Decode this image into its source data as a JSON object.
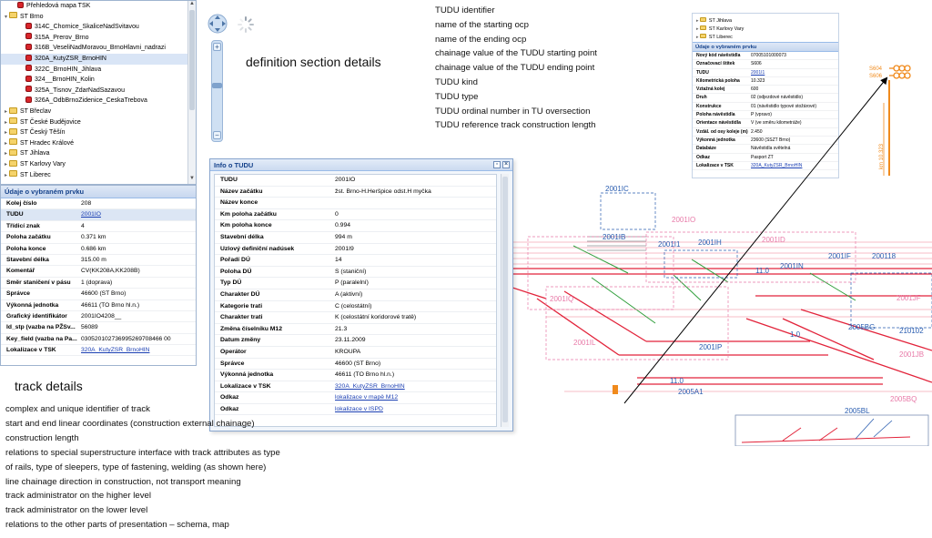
{
  "tree": {
    "items": [
      {
        "label": "Přehledová mapa TSK",
        "indent": 1,
        "icon": "red-layer-icon",
        "expander": ""
      },
      {
        "label": "ST Brno",
        "indent": 0,
        "icon": "folder-icon",
        "expander": "▾"
      },
      {
        "label": "314C_Chornice_SkaliceNadSvitavou",
        "indent": 2,
        "icon": "red-layer-icon",
        "expander": ""
      },
      {
        "label": "315A_Prerov_Brno",
        "indent": 2,
        "icon": "red-layer-icon",
        "expander": ""
      },
      {
        "label": "316B_VeseliNadMoravou_BrnoHlavni_nadrazi",
        "indent": 2,
        "icon": "red-layer-icon",
        "expander": ""
      },
      {
        "label": "320A_KutyZSR_BrnoHIN",
        "indent": 2,
        "icon": "red-layer-icon",
        "expander": "",
        "selected": true
      },
      {
        "label": "322C_BrnoHIN_Jihlava",
        "indent": 2,
        "icon": "red-layer-icon",
        "expander": ""
      },
      {
        "label": "324__BrnoHIN_Kolin",
        "indent": 2,
        "icon": "red-layer-icon",
        "expander": ""
      },
      {
        "label": "325A_Tisnov_ZdarNadSazavou",
        "indent": 2,
        "icon": "red-layer-icon",
        "expander": ""
      },
      {
        "label": "326A_OdbBrnoZidenice_CeskaTrebova",
        "indent": 2,
        "icon": "red-layer-icon",
        "expander": ""
      },
      {
        "label": "ST Břeclav",
        "indent": 0,
        "icon": "folder-icon",
        "expander": "▸"
      },
      {
        "label": "ST České Budějovice",
        "indent": 0,
        "icon": "folder-icon",
        "expander": "▸"
      },
      {
        "label": "ST Český Těšín",
        "indent": 0,
        "icon": "folder-icon",
        "expander": "▸"
      },
      {
        "label": "ST Hradec Králové",
        "indent": 0,
        "icon": "folder-icon",
        "expander": "▸"
      },
      {
        "label": "ST Jihlava",
        "indent": 0,
        "icon": "folder-icon",
        "expander": "▸"
      },
      {
        "label": "ST Karlovy Vary",
        "indent": 0,
        "icon": "folder-icon",
        "expander": "▸"
      },
      {
        "label": "ST Liberec",
        "indent": 0,
        "icon": "folder-icon",
        "expander": "▸"
      }
    ]
  },
  "track_panel": {
    "title": "Údaje o vybraném prvku",
    "rows": [
      {
        "k": "Kolej číslo",
        "v": "208"
      },
      {
        "k": "TUDU",
        "v": "2001IO",
        "link": true,
        "hl": true
      },
      {
        "k": "Třídicí znak",
        "v": "4"
      },
      {
        "k": "Poloha začátku",
        "v": "0.371 km"
      },
      {
        "k": "Poloha konce",
        "v": "0.686 km"
      },
      {
        "k": "Stavební délka",
        "v": "315.00 m"
      },
      {
        "k": "Komentář",
        "v": "CV(KK208A,KK208B)"
      },
      {
        "k": "Směr staničení v pásu",
        "v": "1 (doprava)"
      },
      {
        "k": "Správce",
        "v": "46600 (ST Brno)"
      },
      {
        "k": "Výkonná jednotka",
        "v": "46611 (TO Brno hl.n.)"
      },
      {
        "k": "Grafický identifikátor",
        "v": "2001IO4208__"
      },
      {
        "k": "Id_stp (vazba na PŽSv...",
        "v": "56089"
      },
      {
        "k": "Key_field (vazba na Pa...",
        "v": "030520102736995269708466 00"
      },
      {
        "k": "Lokalizace v TSK",
        "v": "320A_KutyZSR_BrnoHIN",
        "link": true
      }
    ]
  },
  "headings": {
    "definition": "definition section details",
    "track": "track details"
  },
  "tudu_notes": [
    "TUDU identifier",
    "name of the starting ocp",
    "name of the ending ocp",
    "chainage value of the TUDU starting point",
    "chainage value of the TUDU ending point",
    "TUDU kind",
    "TUDU type",
    "TUDU ordinal number in TU oversection",
    "TUDU reference track construction length"
  ],
  "track_notes": [
    "complex and unique identifier of track",
    "start and end linear coordinates (construction external chainage)",
    "construction length",
    "relations to special superstructure interface with track attributes as type",
    "of rails, type of sleepers, type of fastening, welding (as shown here)",
    "line chainage direction in construction, not transport meaning",
    "track administrator on the higher level",
    "track administrator on the lower level",
    "relations to the other parts of presentation – schema, map"
  ],
  "info_window": {
    "title": "Info o TUDU",
    "rows": [
      {
        "k": "TUDU",
        "v": "2001IO"
      },
      {
        "k": "Název začátku",
        "v": "žst. Brno-H.Heršpice odst.H myčka"
      },
      {
        "k": "Název konce",
        "v": ""
      },
      {
        "k": "Km poloha začátku",
        "v": "0"
      },
      {
        "k": "Km poloha konce",
        "v": "0.994"
      },
      {
        "k": "Stavební délka",
        "v": "994 m"
      },
      {
        "k": "Uzlový definiční nadúsek",
        "v": "2001I9"
      },
      {
        "k": "Pořadí DÚ",
        "v": "14"
      },
      {
        "k": "Poloha DÚ",
        "v": "S (staniční)"
      },
      {
        "k": "Typ DÚ",
        "v": "P (paralelní)"
      },
      {
        "k": "Charakter DÚ",
        "v": "A (aktivní)"
      },
      {
        "k": "Kategorie trati",
        "v": "C (celostátní)"
      },
      {
        "k": "Charakter trati",
        "v": "K (celostátní koridorové tratě)"
      },
      {
        "k": "Změna číselníku M12",
        "v": "21.3"
      },
      {
        "k": "Datum změny",
        "v": "23.11.2009"
      },
      {
        "k": "Operátor",
        "v": "KROUPA"
      },
      {
        "k": "Správce",
        "v": "46600 (ST Brno)"
      },
      {
        "k": "Výkonná jednotka",
        "v": "46611 (TO Brno hl.n.)"
      },
      {
        "k": "Lokalizace v TSK",
        "v": "320A_KutyZSR_BrnoHIN",
        "link": true
      },
      {
        "k": "Odkaz",
        "v": "lokalizace v mapě M12",
        "link": true
      },
      {
        "k": "Odkaz",
        "v": "lokalizace v ISPD",
        "link": true
      }
    ]
  },
  "right_panel": {
    "tree": [
      "ST Jihlava",
      "ST Karlovy Vary",
      "ST Liberec"
    ],
    "title": "Údaje o vybraném prvku",
    "rows": [
      {
        "k": "Nový kód návěstidla",
        "v": "07005101000073"
      },
      {
        "k": "Označovací štítek",
        "v": "S606"
      },
      {
        "k": "TUDU",
        "v": "2001I1",
        "link": true
      },
      {
        "k": "Kilometrická poloha",
        "v": "10.323"
      },
      {
        "k": "Vztažná kolej",
        "v": "600"
      },
      {
        "k": "Druh",
        "v": "02 (odjezdové návěstidlo)"
      },
      {
        "k": "Konstrukce",
        "v": "01 (návěstidlo typové stožárové)"
      },
      {
        "k": "Poloha návěstidla",
        "v": "P (vpravo)"
      },
      {
        "k": "Orientace návěstidla",
        "v": "V (ve směru kilometráže)"
      },
      {
        "k": "Vzdál. od osy koleje (m)",
        "v": "2.450"
      },
      {
        "k": "Výkonná jednotka",
        "v": "23600 (SSZT Brno)"
      },
      {
        "k": "Databáze",
        "v": "Návěstidla světelná"
      },
      {
        "k": "Odkaz",
        "v": "Pasport ZT"
      },
      {
        "k": "Lokalizace v TSK",
        "v": "320A_KutyZSR_BrnoHIN",
        "link": true
      }
    ]
  },
  "schema": {
    "labels": [
      "2001IC",
      "2001IO",
      "2001IB",
      "2001I1",
      "2001IH",
      "2001ID",
      "2001IN",
      "2001IF",
      "200118",
      "2001JF",
      "2001IQ",
      "2001IL",
      "2005BG",
      "210102",
      "1.0",
      "2001IP",
      "2001JB",
      "2005A1",
      "2005BQ",
      "2005BL",
      "11.0",
      "11.0"
    ],
    "signal_labels": [
      "S604",
      "S606"
    ],
    "km_label": "km 10.323"
  },
  "colors": {
    "red_track": "#e2233a",
    "blue_label": "#2a5db0",
    "pink_label": "#e87aa8",
    "green_track": "#2e9e3a",
    "orange_signal": "#f08a1c"
  }
}
